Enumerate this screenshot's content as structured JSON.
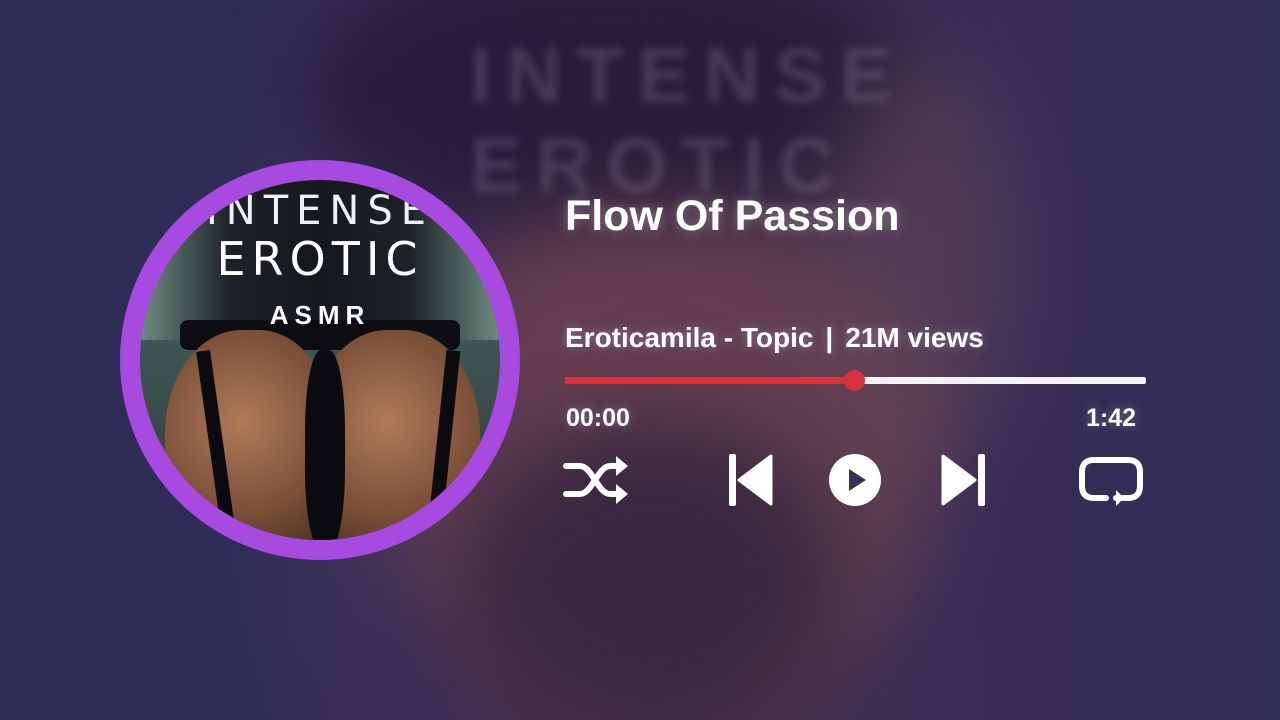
{
  "track": {
    "title": "Flow Of Passion",
    "artist": "Eroticamila - Topic",
    "separator": "|",
    "views": "21M views"
  },
  "album_art": {
    "line1": "INTENSE",
    "line2": "EROTIC",
    "line3": "ASMR"
  },
  "player": {
    "current_time": "00:00",
    "duration": "1:42",
    "progress_fraction": 0.497
  },
  "controls": {
    "shuffle_icon": "shuffle-icon",
    "prev_icon": "skip-previous-icon",
    "play_icon": "play-icon",
    "next_icon": "skip-next-icon",
    "repeat_icon": "repeat-icon"
  },
  "colors": {
    "ring": "#a74ae0",
    "progress_accent": "#d9323f",
    "progress_track": "#f4f2f6",
    "text": "#ffffff"
  }
}
